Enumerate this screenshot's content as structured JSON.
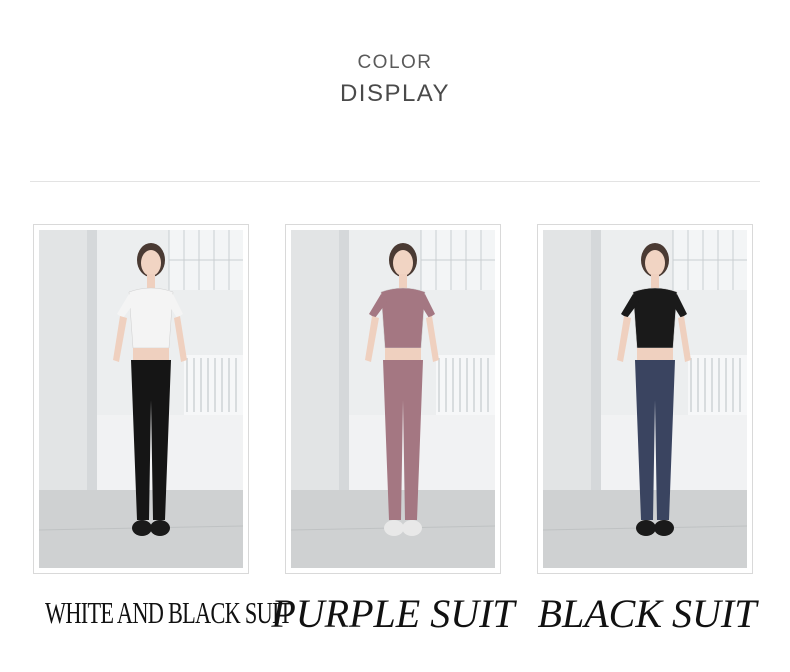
{
  "header": {
    "line1": "COLOR",
    "line2": "DISPLAY"
  },
  "products": [
    {
      "caption": "WHITE AND BLACK SUIT",
      "top_color": "#f4f4f4",
      "bottom_color": "#151515",
      "shoe_color": "#1a1a1a"
    },
    {
      "caption": "PURPLE SUIT",
      "top_color": "#a47782",
      "bottom_color": "#a47782",
      "shoe_color": "#e8e8e8"
    },
    {
      "caption": "BLACK SUIT",
      "top_color": "#1a1a1a",
      "bottom_color": "#3a4460",
      "shoe_color": "#1a1a1a"
    }
  ]
}
